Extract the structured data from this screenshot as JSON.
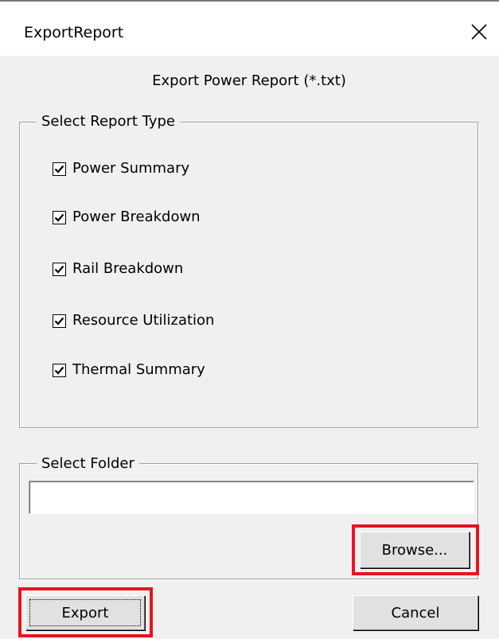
{
  "window": {
    "title": "ExportReport",
    "close_icon": "close-icon"
  },
  "header": {
    "label": "Export Power Report (*.txt)"
  },
  "report_type": {
    "legend": "Select Report Type",
    "items": [
      {
        "label": "Power Summary",
        "checked": true
      },
      {
        "label": "Power Breakdown",
        "checked": true
      },
      {
        "label": "Rail Breakdown",
        "checked": true
      },
      {
        "label": "Resource Utilization",
        "checked": true
      },
      {
        "label": "Thermal Summary",
        "checked": true
      }
    ]
  },
  "folder": {
    "legend": "Select Folder",
    "value": "",
    "browse_label": "Browse..."
  },
  "footer": {
    "export_label": "Export",
    "cancel_label": "Cancel"
  },
  "colors": {
    "highlight": "#e8131f",
    "dialog_bg": "#f0f0f0",
    "button_bg": "#e1e1e1"
  }
}
